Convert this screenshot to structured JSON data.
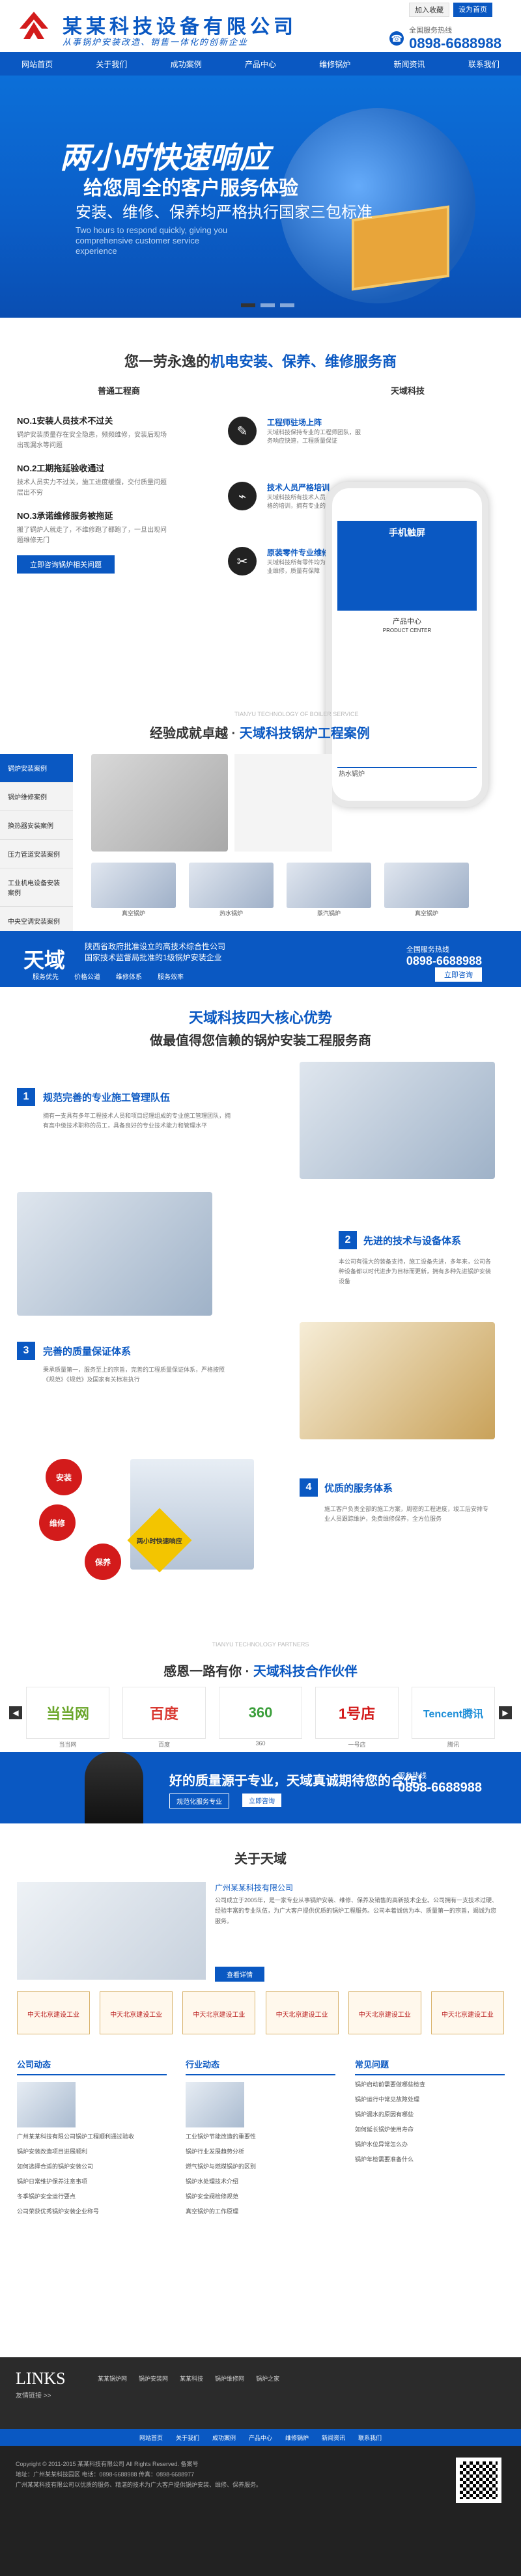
{
  "header": {
    "company": "某某科技设备有限公司",
    "slogan": "从事锅炉安装改造、销售一体化的创新企业",
    "toplinks": [
      "加入收藏",
      "设为首页"
    ],
    "hotline_label": "全国服务热线",
    "hotline": "0898-6688988"
  },
  "nav": [
    "网站首页",
    "关于我们",
    "成功案例",
    "产品中心",
    "维修锅炉",
    "新闻资讯",
    "联系我们"
  ],
  "banner": {
    "h1": "两小时快速响应",
    "h2": "给您周全的客户服务体验",
    "h3": "安装、维修、保养均严格执行国家三包标准",
    "en": "Two hours to respond quickly, giving you comprehensive customer service experience"
  },
  "section1": {
    "title_a": "您一劳永逸的",
    "title_b": "机电安装、保养、维修服务商",
    "cap_left": "普通工程商",
    "cap_right": "天域科技",
    "left": [
      {
        "h": "NO.1安装人员技术不过关",
        "p": "锅炉安装质量存在安全隐患，频频维修，安装后现场出现漏水等问题"
      },
      {
        "h": "NO.2工期拖延验收通过",
        "p": "技术人员实力不过关，施工进度缓慢，交付质量问题层出不穷"
      },
      {
        "h": "NO.3承诺维修服务被拖延",
        "p": "搬了锅炉人就走了，不维修跑了都跑了，一旦出现问题维修无门"
      }
    ],
    "btn": "立即咨询锅炉相关问题",
    "right": [
      {
        "t": "工程师驻场上阵",
        "d": "天域科技保持专业的工程师团队，服务响应快速，工程质量保证"
      },
      {
        "t": "技术人员严格培训",
        "d": "天域科技所有技术人员，均接受过严格的培训，拥有专业的技术能力"
      },
      {
        "t": "原装零件专业维修",
        "d": "天域科技所有零件均为原厂配件，专业维修，质量有保障"
      }
    ],
    "phone_title": "手机触屏",
    "phone_pc": "产品中心",
    "phone_pc_en": "PRODUCT CENTER"
  },
  "cases": {
    "en": "TIANYU TECHNOLOGY OF BOILER SERVICE",
    "title_a": "经验成就卓越 · ",
    "title_b": "天域科技锅炉工程案例",
    "tabs": [
      "锅炉安装案例",
      "锅炉维修案例",
      "换热器安装案例",
      "压力管道安装案例",
      "工业机电设备安装案例",
      "中央空调安装案例"
    ],
    "labels": [
      "热水锅炉",
      "真空锅炉",
      "热水锅炉",
      "蒸汽锅炉",
      "真空锅炉"
    ]
  },
  "band": {
    "brand": "天域",
    "line1": "陕西省政府批准设立的高技术综合性公司",
    "line2": "国家技术监督局批准的1级锅炉安装企业",
    "features": [
      "服务优先",
      "价格公道",
      "维修体系",
      "服务效率"
    ],
    "hl_label": "全国服务热线",
    "hotline": "0898-6688988",
    "btn": "立即咨询"
  },
  "adv": {
    "title": "天域科技四大核心优势",
    "subtitle": "做最值得您信赖的锅炉安装工程服务商",
    "items": [
      {
        "n": "1",
        "t": "规范完善的专业施工管理队伍",
        "d": "拥有一支具有多年工程技术人员和项目经理组成的专业施工管理团队，拥有高中级技术职称的员工，具备良好的专业技术能力和管理水平"
      },
      {
        "n": "2",
        "t": "先进的技术与设备体系",
        "d": "本公司有强大的装备支持，施工设备先进，多年来，公司各种设备都以时代进步为目标而更新，拥有多种先进锅炉安装设备"
      },
      {
        "n": "3",
        "t": "完善的质量保证体系",
        "d": "秉承质量第一，服务至上的宗旨，完善的工程质量保证体系，严格按照《规范》《规范》及国家有关标准执行"
      },
      {
        "n": "4",
        "t": "优质的服务体系",
        "d": "施工客户负责全部的施工方案，周密的工程进度，竣工后安排专业人员跟踪维护，免费维修保养，全方位服务"
      }
    ],
    "circles": [
      "安装",
      "维修",
      "保养"
    ],
    "badge": "两小时快速响应"
  },
  "partners": {
    "en": "TIANYU TECHNOLOGY PARTNERS",
    "title_a": "感恩一路有你 · ",
    "title_b": "天域科技合作伙伴",
    "logos": [
      "当当网",
      "百度",
      "360",
      "1号店",
      "Tencent腾讯"
    ],
    "labels": [
      "当当网",
      "百度",
      "360",
      "一号店",
      "腾讯"
    ]
  },
  "quote": {
    "text": "好的质量源于专业，天域真诚期待您的合作！",
    "btn1": "规范化服务专业",
    "btn2": "立即咨询",
    "hl_label": "服务热线",
    "hotline": "0898-6688988"
  },
  "about": {
    "title": "关于天域",
    "company": "广州某某科技有限公司",
    "text": "公司成立于2005年，是一家专业从事锅炉安装、维修、保养及销售的高新技术企业。公司拥有一支技术过硬、经验丰富的专业队伍，为广大客户提供优质的锅炉工程服务。公司本着诚信为本、质量第一的宗旨，竭诚为您服务。",
    "btn": "查看详情",
    "certs": [
      "中天北京建设工业",
      "中天北京建设工业",
      "中天北京建设工业",
      "中天北京建设工业",
      "中天北京建设工业",
      "中天北京建设工业"
    ]
  },
  "news": {
    "cols": [
      {
        "h": "公司动态",
        "items": [
          "广州某某科技有限公司锅炉工程顺利通过验收",
          "锅炉安装改造项目进展顺利",
          "如何选择合适的锅炉安装公司",
          "锅炉日常维护保养注意事项",
          "冬季锅炉安全运行要点",
          "公司荣获优秀锅炉安装企业称号"
        ]
      },
      {
        "h": "行业动态",
        "items": [
          "工业锅炉节能改造的重要性",
          "锅炉行业发展趋势分析",
          "燃气锅炉与燃煤锅炉的区别",
          "锅炉水处理技术介绍",
          "锅炉安全阀检修规范",
          "真空锅炉的工作原理"
        ]
      },
      {
        "h": "常见问题",
        "items": [
          "锅炉启动前需要做哪些检查",
          "锅炉运行中常见故障处理",
          "锅炉漏水的原因有哪些",
          "如何延长锅炉使用寿命",
          "锅炉水位异常怎么办",
          "锅炉年检需要准备什么"
        ]
      }
    ]
  },
  "links": {
    "title": "LINKS",
    "sub": "友情链接 >>",
    "items": [
      "某某锅炉网",
      "锅炉安装网",
      "某某科技",
      "锅炉维修网",
      "锅炉之家"
    ]
  },
  "footnav": [
    "网站首页",
    "关于我们",
    "成功案例",
    "产品中心",
    "维修锅炉",
    "新闻资讯",
    "联系我们"
  ],
  "footer": {
    "copyright": "Copyright © 2011-2015 某某科技有限公司 All Rights Reserved. 备案号",
    "address": "地址：广州某某科技园区 电话：0898-6688988 传真：0898-6688977",
    "note": "广州某某科技有限公司以优质的服务、精湛的技术为广大客户提供锅炉安装、维修、保养服务。"
  }
}
